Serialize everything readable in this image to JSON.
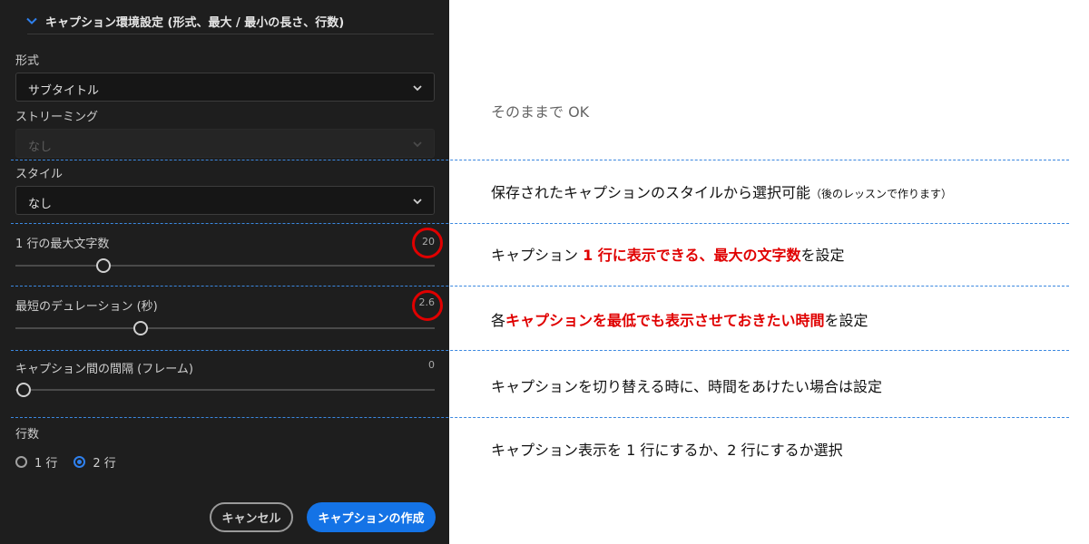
{
  "panel": {
    "header": "キャプション環境設定 (形式、最大 / 最小の長さ、行数)",
    "format": {
      "label": "形式",
      "value": "サブタイトル"
    },
    "streaming": {
      "label": "ストリーミング",
      "value": "なし"
    },
    "style": {
      "label": "スタイル",
      "value": "なし"
    },
    "max_chars": {
      "label": "1 行の最大文字数",
      "value": 20
    },
    "min_duration": {
      "label": "最短のデュレーション (秒)",
      "value": 2.6
    },
    "gap": {
      "label": "キャプション間の間隔 (フレーム)",
      "value": 0
    },
    "lines": {
      "label": "行数",
      "options": [
        "1 行",
        "2 行"
      ],
      "selected": "2 行"
    },
    "buttons": {
      "cancel": "キャンセル",
      "create": "キャプションの作成"
    }
  },
  "notes": {
    "n1": "そのままで OK",
    "n2_main": "保存されたキャプションのスタイルから選択可能",
    "n2_small": "（後のレッスンで作ります）",
    "n3_a": "キャプション ",
    "n3_red": "1 行に表示できる、最大の文字数",
    "n3_b": "を設定",
    "n4_a": "各",
    "n4_red": "キャプションを最低でも表示させておきたい時間",
    "n4_b": "を設定",
    "n5": "キャプションを切り替える時に、時間をあけたい場合は設定",
    "n6": "キャプション表示を 1 行にするか、2 行にするか選択"
  },
  "colors": {
    "accent": "#1473e6",
    "highlight": "#e00000",
    "divider": "#3b88e0",
    "panel_bg": "#1e1e1e"
  }
}
